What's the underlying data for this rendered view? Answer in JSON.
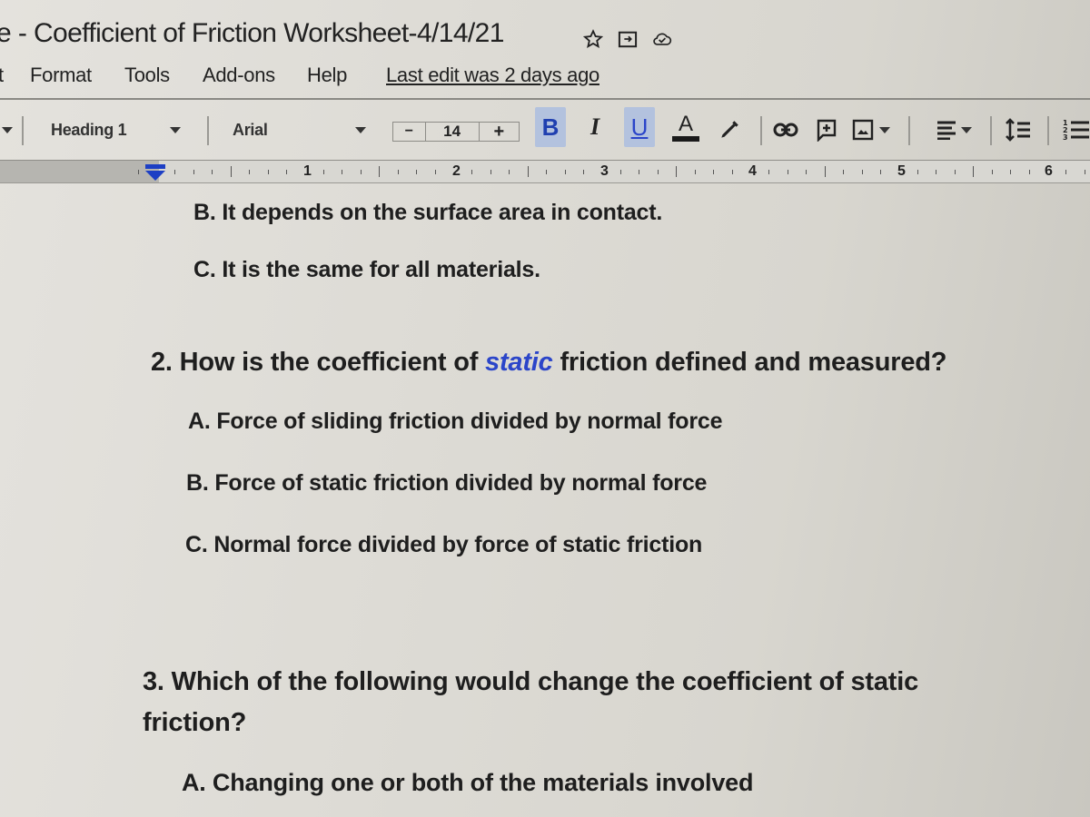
{
  "window": {
    "title": "e - Coefficient of Friction Worksheet-4/14/21",
    "title_icons": [
      "star-icon",
      "move-to-folder-icon",
      "cloud-saved-icon"
    ]
  },
  "menu": {
    "items": [
      {
        "label": "t"
      },
      {
        "label": "Format"
      },
      {
        "label": "Tools"
      },
      {
        "label": "Add-ons"
      },
      {
        "label": "Help"
      }
    ],
    "last_edit": "Last edit was 2 days ago"
  },
  "toolbar": {
    "style_select": "Heading 1",
    "font_select": "Arial",
    "font_size": "14",
    "decrease_label": "−",
    "increase_label": "+",
    "bold_label": "B",
    "italic_label": "I",
    "underline_label": "U",
    "text_color_label": "A",
    "active_formats": [
      "bold",
      "underline"
    ],
    "accent_active_bg": "#b3c2de",
    "bold_color": "#1f3fb0"
  },
  "ruler": {
    "numbers": [
      "1",
      "2",
      "3",
      "4",
      "5",
      "6"
    ]
  },
  "document": {
    "accent_color": "#2b45c9",
    "q1_options": [
      {
        "letter": "B.",
        "text": "It depends on the surface area in contact."
      },
      {
        "letter": "C.",
        "text": "It is the same for all materials."
      }
    ],
    "q2": {
      "prefix": "2. How is the coefficient of ",
      "highlight": "static",
      "suffix": " friction defined and measured?",
      "options": [
        {
          "letter": "A.",
          "text": "Force of sliding friction divided by normal force"
        },
        {
          "letter": "B.",
          "text": "Force of static friction divided by normal force"
        },
        {
          "letter": "C.",
          "text": "Normal force divided by force of static friction"
        }
      ]
    },
    "q3": {
      "line1": "3. Which of the following would change the coefficient of static",
      "line2": "friction?",
      "options": [
        {
          "letter": "A.",
          "text": "Changing one or both of the materials involved"
        }
      ]
    }
  }
}
